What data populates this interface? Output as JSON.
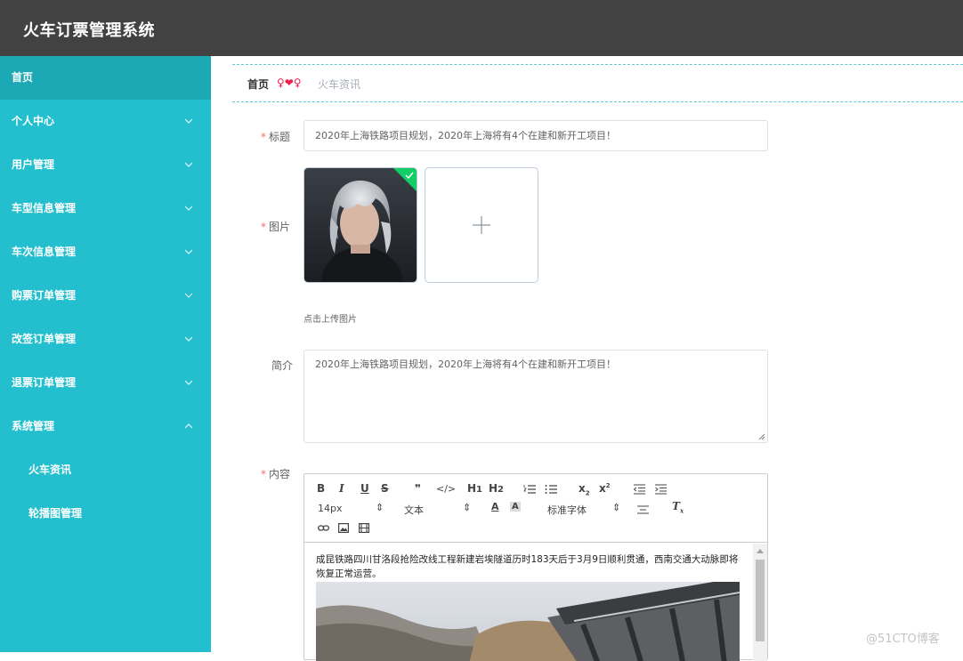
{
  "header": {
    "title": "火车订票管理系统"
  },
  "sidebar": {
    "home": "首页",
    "items": [
      {
        "label": "个人中心",
        "expanded": false
      },
      {
        "label": "用户管理",
        "expanded": false
      },
      {
        "label": "车型信息管理",
        "expanded": false
      },
      {
        "label": "车次信息管理",
        "expanded": false
      },
      {
        "label": "购票订单管理",
        "expanded": false
      },
      {
        "label": "改签订单管理",
        "expanded": false
      },
      {
        "label": "退票订单管理",
        "expanded": false
      },
      {
        "label": "系统管理",
        "expanded": true
      }
    ],
    "subitems": [
      "火车资讯",
      "轮播图管理"
    ]
  },
  "breadcrumb": {
    "home": "首页",
    "decoration": "♀❤♀",
    "current": "火车资讯"
  },
  "form": {
    "title_label": "标题",
    "title_value": "2020年上海铁路项目规划，2020年上海将有4个在建和新开工项目！",
    "image_label": "图片",
    "upload_hint": "点击上传图片",
    "intro_label": "简介",
    "intro_value": "2020年上海铁路项目规划，2020年上海将有4个在建和新开工项目！",
    "content_label": "内容"
  },
  "editor": {
    "toolbar_row1": [
      "B",
      "I",
      "U",
      "S",
      "99",
      "</>",
      "H1",
      "H2",
      "ordered-list",
      "bullet-list",
      "x2-sub",
      "x2-sup",
      "outdent",
      "indent"
    ],
    "font_size": "14px",
    "header_select": "文本",
    "font_select": "标准字体",
    "content_text": "成昆铁路四川甘洛段抢险改线工程新建岩埃隧道历时183天后于3月9日顺利贯通，西南交通大动脉即将恢复正常运营。"
  },
  "watermark": "@51CTO博客",
  "colors": {
    "topbar": "#424242",
    "sidebar": "#23bfce",
    "sidebar_active": "#1da8b5",
    "required": "#f56c6c",
    "accent_line": "#5ec8d3"
  }
}
